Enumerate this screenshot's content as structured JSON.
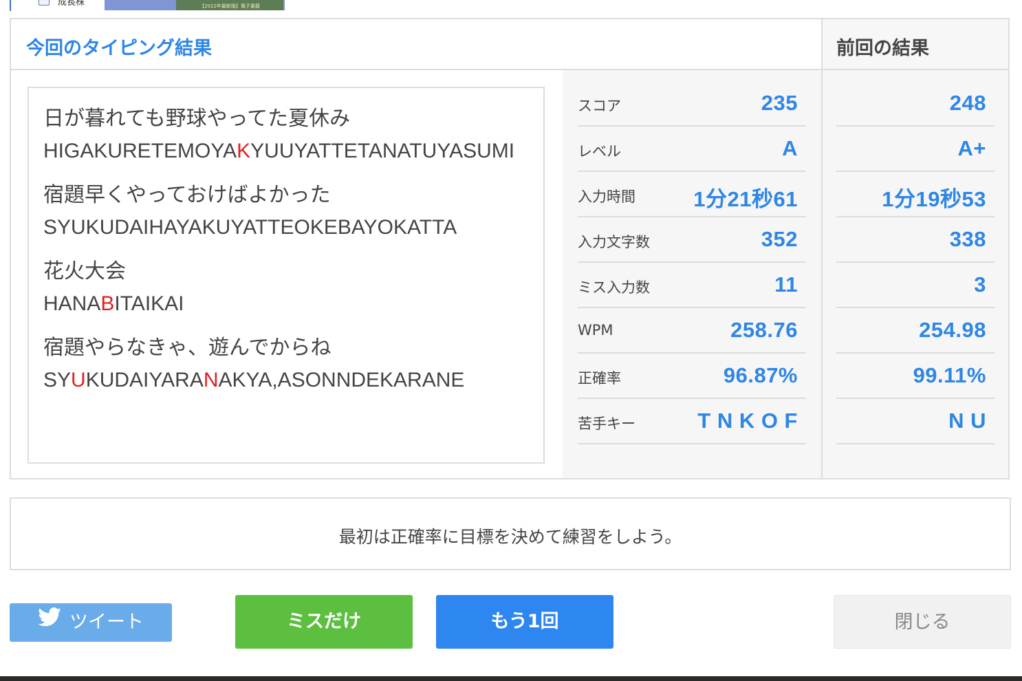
{
  "top_strip": {
    "text": "成長株",
    "banner_text": "【2022年最新版】電子書籍"
  },
  "result": {
    "title": "今回のタイピング結果",
    "prev_title": "前回の結果",
    "lines": [
      {
        "ja": "日が暮れても野球やってた夏休み",
        "ro": [
          "HIGAKURETEMOYA",
          "K",
          "YUUYATTETANATUYASUMI"
        ]
      },
      {
        "ja": "宿題早くやっておけばよかった",
        "ro": [
          "SYUKUDAIHAYAKUYATTEOKEBAYOKATTA"
        ]
      },
      {
        "ja": "花火大会",
        "ro": [
          "HANA",
          "B",
          "ITAIKAI"
        ]
      },
      {
        "ja": "宿題やらなきゃ、遊んでからね",
        "ro": [
          "SY",
          "U",
          "KUDAIYARA",
          "N",
          "AKYA,ASONNDEKARANE"
        ]
      }
    ],
    "stats": [
      {
        "label": "スコア",
        "current": "235",
        "previous": "248"
      },
      {
        "label": "レベル",
        "current": "A",
        "previous": "A+"
      },
      {
        "label": "入力時間",
        "current": "1分21秒61",
        "previous": "1分19秒53"
      },
      {
        "label": "入力文字数",
        "current": "352",
        "previous": "338"
      },
      {
        "label": "ミス入力数",
        "current": "11",
        "previous": "3"
      },
      {
        "label": "WPM",
        "current": "258.76",
        "previous": "254.98"
      },
      {
        "label": "正確率",
        "current": "96.87%",
        "previous": "99.11%"
      },
      {
        "label": "苦手キー",
        "current": "T N K O F",
        "previous": "N U"
      }
    ]
  },
  "advice": "最初は正確率に目標を決めて練習をしよう。",
  "buttons": {
    "tweet": "ツイート",
    "miss_only": "ミスだけ",
    "again": "もう1回",
    "close": "閉じる"
  },
  "colors": {
    "accent": "#2e86e5",
    "miss": "#e02020",
    "green": "#5cbf3f",
    "blue": "#2e86f0",
    "twitter": "#6aabea"
  }
}
